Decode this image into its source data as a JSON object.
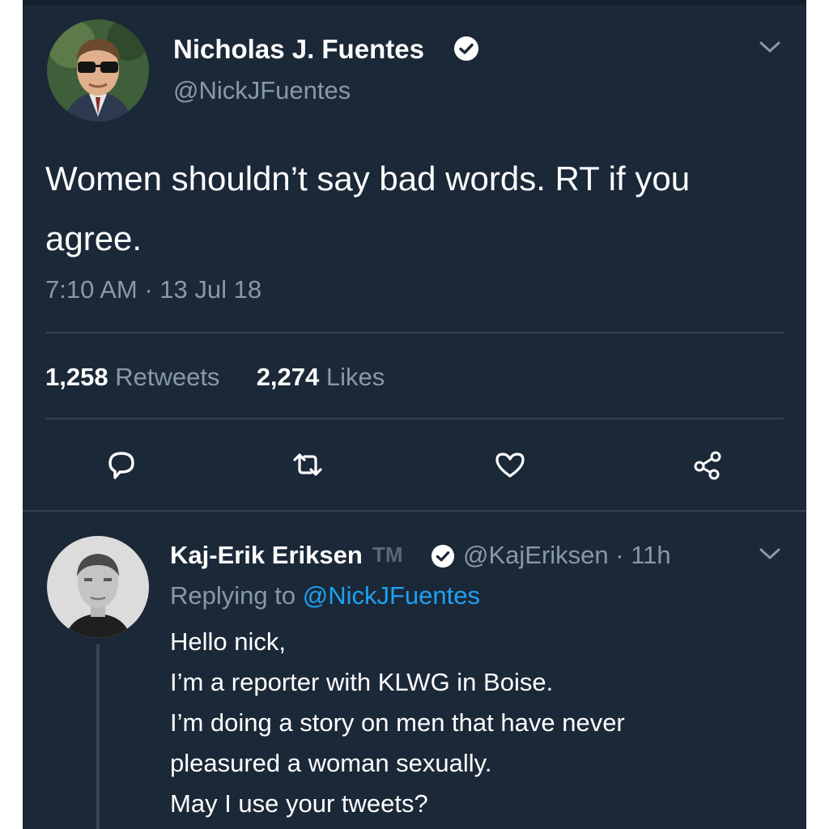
{
  "tweet": {
    "author_name": "Nicholas J. Fuentes",
    "author_handle": "@NickJFuentes",
    "text": "Women shouldn’t say bad words. RT if you agree.",
    "timestamp": "7:10 AM · 13 Jul 18",
    "retweets_count": "1,258",
    "retweets_label": "Retweets",
    "likes_count": "2,274",
    "likes_label": "Likes",
    "verified": true
  },
  "actions": {
    "reply_icon": "reply-icon",
    "retweet_icon": "retweet-icon",
    "like_icon": "heart-icon",
    "share_icon": "share-icon"
  },
  "reply": {
    "author_name": "Kaj-Erik Eriksen",
    "tm": "TM",
    "handle_time": "@KajEriksen · 11h",
    "replying_prefix": "Replying to",
    "replying_mention": "@NickJFuentes",
    "lines": [
      "Hello nick,",
      "I’m a reporter with KLWG in Boise.",
      "I’m doing a story on men that have never",
      "pleasured a woman sexually.",
      "May I use your tweets?"
    ],
    "verified": true
  },
  "colors": {
    "background": "#1b2838",
    "text_primary": "#ffffff",
    "text_secondary": "#8899a6",
    "accent": "#1da1f2",
    "divider": "#38444d"
  }
}
